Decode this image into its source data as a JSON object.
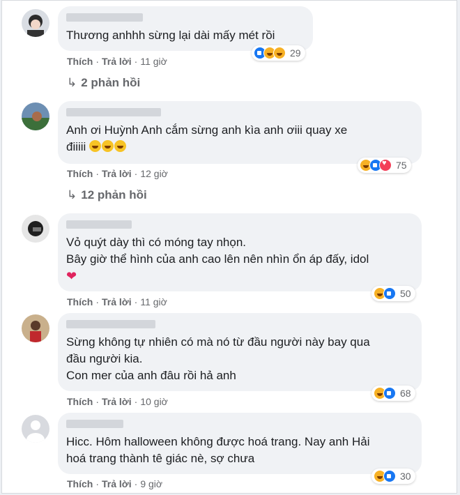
{
  "colors": {
    "bubble_bg": "#f0f2f5",
    "action_text": "#65676b",
    "like": "#1877f2",
    "haha": "#f7b125",
    "love": "#f33e58"
  },
  "labels": {
    "like": "Thích",
    "reply": "Trả lời"
  },
  "comments": [
    {
      "lines": [
        "Thương anhhh sừng lại dài mấy mét rồi"
      ],
      "time": "11 giờ",
      "reaction_icons": [
        "like-icon",
        "haha-icon",
        "haha-icon"
      ],
      "reaction_count": "29",
      "replies": "2 phản hồi"
    },
    {
      "lines": [
        "Anh ơi Huỳnh Anh cắm sừng anh kìa anh ơiii quay xe",
        "điiiii"
      ],
      "time": "12 giờ",
      "reaction_icons": [
        "haha-icon",
        "like-icon",
        "love-icon"
      ],
      "reaction_count": "75",
      "replies": "12 phản hồi"
    },
    {
      "lines": [
        "Vỏ quýt dày thì có móng tay nhọn.",
        "Bây giờ thể hình của anh cao lên nên nhìn ổn áp đấy, idol"
      ],
      "time": "11 giờ",
      "reaction_icons": [
        "haha-icon",
        "like-icon"
      ],
      "reaction_count": "50"
    },
    {
      "lines": [
        "Sừng không tự nhiên có mà nó từ đầu người này bay qua",
        "đầu người kia.",
        "Con mer của anh đâu rồi hả anh"
      ],
      "time": "10 giờ",
      "reaction_icons": [
        "haha-icon",
        "like-icon"
      ],
      "reaction_count": "68"
    },
    {
      "lines": [
        "Hicc. Hôm halloween không được hoá trang. Nay anh Hải",
        "hoá trang thành tê giác nè, sợ chưa"
      ],
      "time": "9 giờ",
      "reaction_icons": [
        "haha-icon",
        "like-icon"
      ],
      "reaction_count": "30"
    }
  ]
}
